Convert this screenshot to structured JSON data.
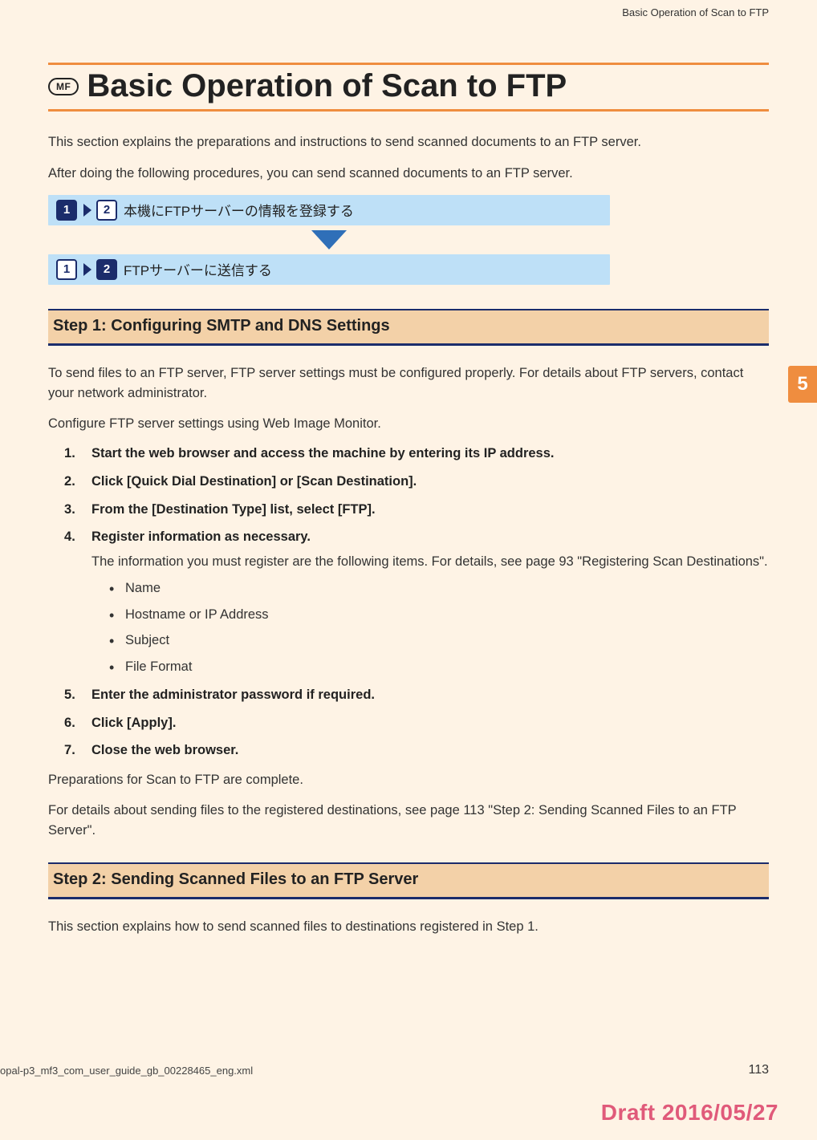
{
  "running_head": "Basic Operation of Scan to FTP",
  "badge_label": "MF",
  "title": "Basic Operation of Scan to FTP",
  "intro": {
    "p1": "This section explains the preparations and instructions to send scanned documents to an FTP server.",
    "p2": "After doing the following procedures, you can send scanned documents to an FTP server."
  },
  "flow": {
    "step1": {
      "badge_a": "1",
      "badge_b": "2",
      "text": "本機にFTPサーバーの情報を登録する"
    },
    "step2": {
      "badge_a": "1",
      "badge_b": "2",
      "text": "FTPサーバーに送信する"
    }
  },
  "sections": {
    "s1": {
      "heading": "Step 1: Configuring SMTP and DNS Settings",
      "p1": "To send files to an FTP server, FTP server settings must be configured properly. For details about FTP servers, contact your network administrator.",
      "p2": "Configure FTP server settings using Web Image Monitor.",
      "steps": {
        "i1": "Start the web browser and access the machine by entering its IP address.",
        "i2": "Click [Quick Dial Destination] or [Scan Destination].",
        "i3": "From the [Destination Type] list, select [FTP].",
        "i4": "Register information as necessary.",
        "i4_body": "The information you must register are the following items. For details, see page 93 \"Registering Scan Destinations\".",
        "i4_bullets": {
          "b1": "Name",
          "b2": "Hostname or IP Address",
          "b3": "Subject",
          "b4": "File Format"
        },
        "i5": "Enter the administrator password if required.",
        "i6": "Click [Apply].",
        "i7": "Close the web browser."
      },
      "p3": "Preparations for Scan to FTP are complete.",
      "p4": "For details about sending files to the registered destinations, see page 113 \"Step 2: Sending Scanned Files to an FTP Server\"."
    },
    "s2": {
      "heading": "Step 2: Sending Scanned Files to an FTP Server",
      "p1": "This section explains how to send scanned files to destinations registered in Step 1."
    }
  },
  "side_tab": "5",
  "footer": {
    "file": "opal-p3_mf3_com_user_guide_gb_00228465_eng.xml",
    "page": "113",
    "draft": "Draft 2016/05/27"
  }
}
